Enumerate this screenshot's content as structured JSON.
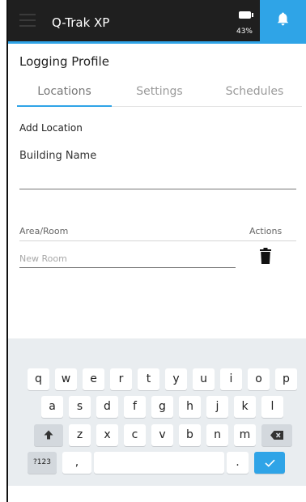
{
  "appbar": {
    "title": "Q-Trak XP",
    "battery_percent": "43%",
    "menu_icon": "hamburger-menu-icon",
    "bell_icon": "bell-icon",
    "accent_color": "#2fa4e7",
    "bar_color": "#1f1f1f"
  },
  "page": {
    "title": "Logging Profile"
  },
  "tabs": [
    {
      "label": "Locations",
      "active": true
    },
    {
      "label": "Settings",
      "active": false
    },
    {
      "label": "Schedules",
      "active": false
    }
  ],
  "form": {
    "section_label": "Add Location",
    "building_label": "Building Name",
    "building_value": "",
    "area_column": "Area/Room",
    "actions_column": "Actions",
    "room_placeholder": "New Room",
    "room_value": "",
    "delete_icon": "trash-icon"
  },
  "keyboard": {
    "row1": [
      "q",
      "w",
      "e",
      "r",
      "t",
      "y",
      "u",
      "i",
      "o",
      "p"
    ],
    "row2": [
      "a",
      "s",
      "d",
      "f",
      "g",
      "h",
      "j",
      "k",
      "l"
    ],
    "row3": [
      "z",
      "x",
      "c",
      "v",
      "b",
      "n",
      "m"
    ],
    "symbols_key": "?123",
    "comma_key": ",",
    "period_key": ".",
    "shift_icon": "shift-arrow-icon",
    "backspace_icon": "backspace-icon",
    "enter_icon": "checkmark-icon"
  }
}
